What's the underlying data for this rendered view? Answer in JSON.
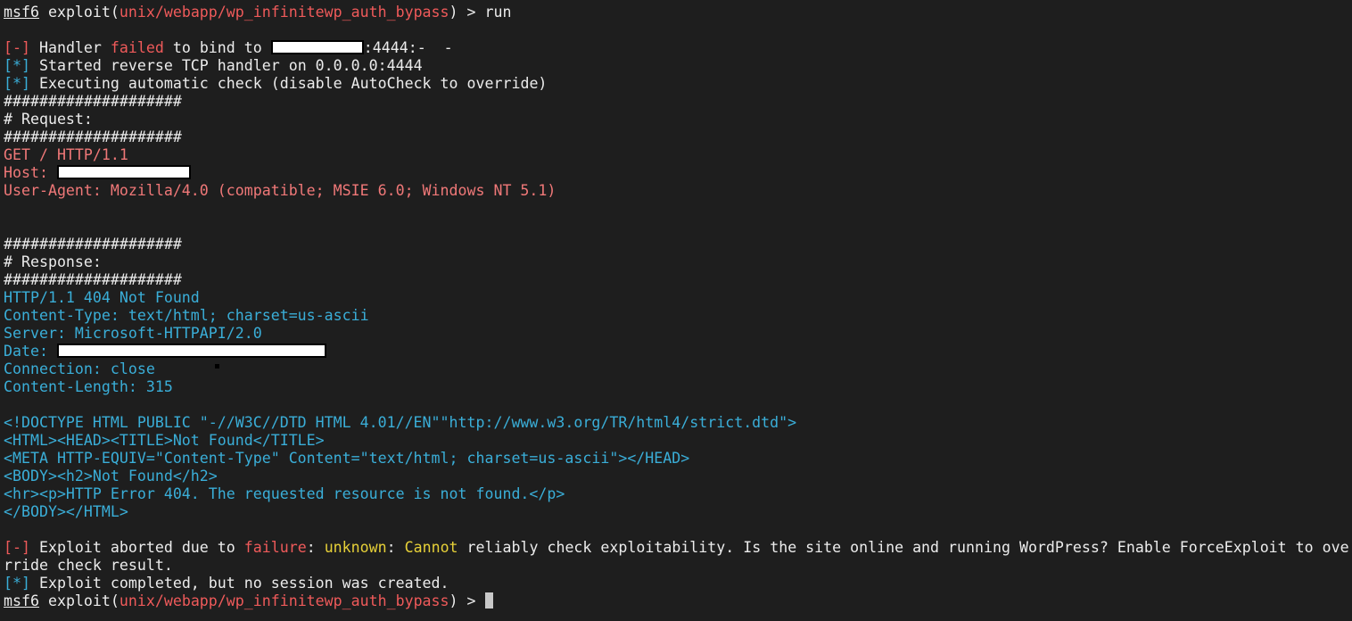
{
  "prompt": {
    "msf": "msf6",
    "exploit_word": " exploit(",
    "module": "unix/webapp/wp_infinitewp_auth_bypass",
    "close_suffix": ") > ",
    "command": "run"
  },
  "handler_fail": {
    "marker": "[-]",
    "text1": " Handler ",
    "failed_word": "failed",
    "text2": " to bind to ",
    "text3": ":4444:-  -"
  },
  "started": {
    "marker": "[*]",
    "text": " Started reverse TCP handler on 0.0.0.0:4444"
  },
  "executing": {
    "marker": "[*]",
    "text": " Executing automatic check (disable AutoCheck to override)"
  },
  "hash_line": "####################",
  "request_header": "# Request:",
  "request": {
    "get": "GET / HTTP/1.1",
    "host_label": "Host: ",
    "user_agent": "User-Agent: Mozilla/4.0 (compatible; MSIE 6.0; Windows NT 5.1)"
  },
  "response_header": "# Response:",
  "response": {
    "status": "HTTP/1.1 404 Not Found",
    "content_type": "Content-Type: text/html; charset=us-ascii",
    "server": "Server: Microsoft-HTTPAPI/2.0",
    "date_label": "Date: ",
    "connection": "Connection: close",
    "content_length": "Content-Length: 315"
  },
  "html_body": [
    "<!DOCTYPE HTML PUBLIC \"-//W3C//DTD HTML 4.01//EN\"\"http://www.w3.org/TR/html4/strict.dtd\">",
    "<HTML><HEAD><TITLE>Not Found</TITLE>",
    "<META HTTP-EQUIV=\"Content-Type\" Content=\"text/html; charset=us-ascii\"></HEAD>",
    "<BODY><h2>Not Found</h2>",
    "<hr><p>HTTP Error 404. The requested resource is not found.</p>",
    "</BODY></HTML>"
  ],
  "abort": {
    "marker": "[-]",
    "text1": " Exploit aborted due to ",
    "failure_word": "failure",
    "colon": ": ",
    "unknown_word": "unknown",
    "colon2": ": ",
    "cannot_word": "Cannot",
    "text2": " reliably check exploitability. Is the site online and running WordPress? Enable ForceExploit to ove",
    "wrap": "rride check result."
  },
  "completed": {
    "marker": "[*]",
    "text": " Exploit completed, but no session was created."
  },
  "colors": {
    "background": "#1e1e1e",
    "foreground": "#ececec",
    "error_red": "#ef5a5a",
    "request_salmon": "#f07878",
    "response_cyan": "#3aaed8",
    "warning_yellow": "#e6d038",
    "redaction": "#ffffff"
  }
}
